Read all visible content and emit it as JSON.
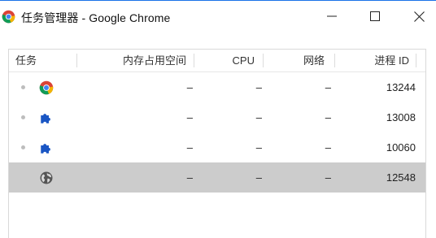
{
  "window": {
    "title": "任务管理器 - Google Chrome",
    "app_icon": "chrome-logo-icon",
    "controls": {
      "minimize_icon": "minimize-icon",
      "maximize_icon": "maximize-icon",
      "close_icon": "close-icon"
    },
    "accent_color": "#1a73e8"
  },
  "table": {
    "columns": [
      "任务",
      "内存占用空间",
      "CPU",
      "网络",
      "进程 ID"
    ],
    "rows": [
      {
        "icon": "chrome-logo-icon",
        "memory": "–",
        "cpu": "–",
        "network": "–",
        "pid": "13244",
        "selected": false
      },
      {
        "icon": "puzzle-extension-icon",
        "memory": "–",
        "cpu": "–",
        "network": "–",
        "pid": "13008",
        "selected": false
      },
      {
        "icon": "puzzle-extension-icon",
        "memory": "–",
        "cpu": "–",
        "network": "–",
        "pid": "10060",
        "selected": false
      },
      {
        "icon": "globe-icon",
        "memory": "–",
        "cpu": "–",
        "network": "–",
        "pid": "12548",
        "selected": true
      }
    ],
    "selected_row_color": "#cccccc"
  }
}
